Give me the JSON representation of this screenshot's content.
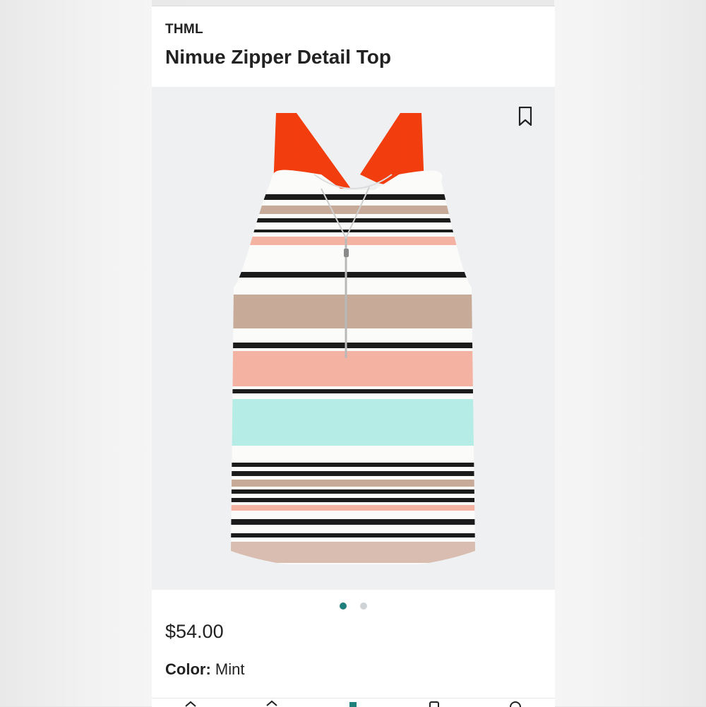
{
  "product": {
    "brand": "THML",
    "name": "Nimue Zipper Detail Top",
    "price": "$54.00",
    "color_label": "Color:",
    "color_value": "Mint"
  },
  "gallery": {
    "image_count": 2,
    "active_index": 0,
    "bookmark_icon": "bookmark-icon"
  },
  "colors": {
    "accent": "#1f7f7b",
    "strap": "#f23d0e",
    "stripe_black": "#1b1b1b",
    "stripe_tan": "#c7aa98",
    "stripe_pink": "#f4b3a2",
    "stripe_mint": "#b5ece6",
    "background": "#eef0f2"
  },
  "bottom_nav": {
    "icons": [
      "home-icon",
      "shop-icon",
      "style-icon",
      "bag-icon",
      "account-icon"
    ]
  }
}
